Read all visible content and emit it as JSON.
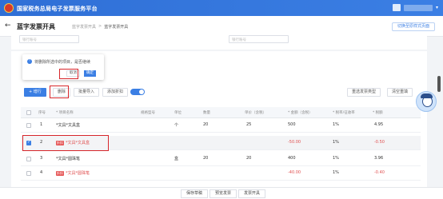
{
  "header": {
    "app_title": "国家税务总局电子发票服务平台"
  },
  "subheader": {
    "back_icon": "←",
    "page_title": "蓝字发票开具",
    "breadcrumb": [
      "蓝字发票开具",
      ">",
      "蓝字发票开具"
    ],
    "switch_button": "切换至原样式页面"
  },
  "top_fields": {
    "left_placeholder": "银行账号",
    "right_placeholder": "银行账号"
  },
  "popconfirm": {
    "message": "将删除所选中的项目，是否继续",
    "cancel_label": "取消",
    "ok_label": "确定"
  },
  "toolbar": {
    "add_row": "+ 增行",
    "delete": "删除",
    "batch_import": "批量导入",
    "add_discount": "添加折扣",
    "select_invoice_type": "重选发票类型",
    "clear_rebuild": "清空重填"
  },
  "table": {
    "headers": [
      "序号",
      "* 项目名称",
      "规格型号",
      "单位",
      "数量",
      "单价（含税）",
      "* 金额（含税）",
      "* 税率/征收率",
      "* 税额"
    ],
    "rows": [
      {
        "no": "1",
        "tag": "",
        "name": "*文具*文具盒",
        "unit": "个",
        "qty": "20",
        "price": "25",
        "amount": "500",
        "rate": "1%",
        "tax": "4.95",
        "checked": false,
        "negative": false
      },
      {
        "no": "2",
        "tag": "折扣",
        "name": "*文具*文具盒",
        "unit": "",
        "qty": "",
        "price": "",
        "amount": "-50.00",
        "rate": "1%",
        "tax": "-0.50",
        "checked": true,
        "negative": true
      },
      {
        "no": "3",
        "tag": "",
        "name": "*文具*圆珠笔",
        "unit": "盒",
        "qty": "20",
        "price": "20",
        "amount": "400",
        "rate": "1%",
        "tax": "3.96",
        "checked": false,
        "negative": false
      },
      {
        "no": "4",
        "tag": "折扣",
        "name": "*文具*圆珠笔",
        "unit": "",
        "qty": "",
        "price": "",
        "amount": "-40.00",
        "rate": "1%",
        "tax": "-0.40",
        "checked": false,
        "negative": true
      }
    ]
  },
  "footer": {
    "save_draft": "保存草稿",
    "preview": "预览发票",
    "issue": "发票开具"
  },
  "colors": {
    "primary": "#3b7fe4",
    "highlight_red": "#d7262b"
  }
}
